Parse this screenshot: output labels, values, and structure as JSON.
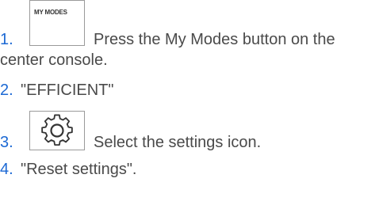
{
  "steps": [
    {
      "number": "1.",
      "icon": "my-modes-button-icon",
      "icon_text": "MY MODES",
      "text_line1": "Press the My Modes button on the",
      "text_line2": "center console."
    },
    {
      "number": "2.",
      "text": "\"EFFICIENT\""
    },
    {
      "number": "3.",
      "icon": "settings-gear-icon",
      "text": "Select the settings icon."
    },
    {
      "number": "4.",
      "text": "\"Reset settings\"."
    }
  ],
  "colors": {
    "number": "#1c69d4",
    "text": "#4a4a4a",
    "icon_border": "#9a9a9a"
  }
}
